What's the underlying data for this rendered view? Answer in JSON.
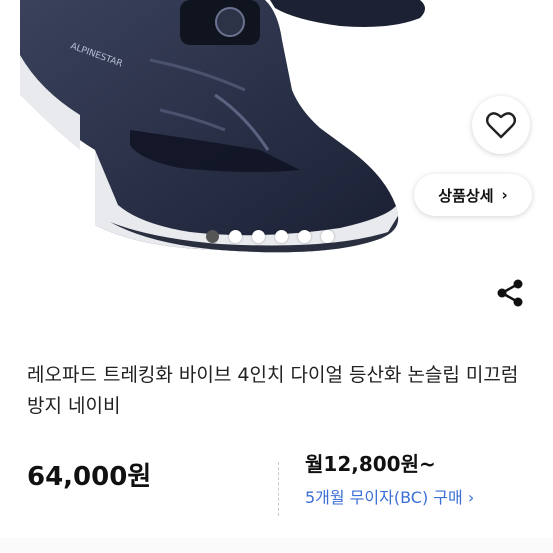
{
  "hero": {
    "brand_on_shoe": "ALPINESTAR",
    "dots_count": 6,
    "active_dot": 0
  },
  "actions": {
    "wishlist_icon": "heart-icon",
    "share_icon": "share-icon",
    "detail_label": "상품상세",
    "detail_chevron": "›"
  },
  "product": {
    "title": "레오파드 트레킹화 바이브 4인치 다이얼 등산화 논슬립 미끄럼방지 네이비",
    "price": "64,000원",
    "monthly_price": "월12,800원~",
    "installment": "5개월 무이자(BC) 구매 ›"
  },
  "colors": {
    "navy": "#1f2438",
    "accent_blue": "#3b6fd6"
  }
}
